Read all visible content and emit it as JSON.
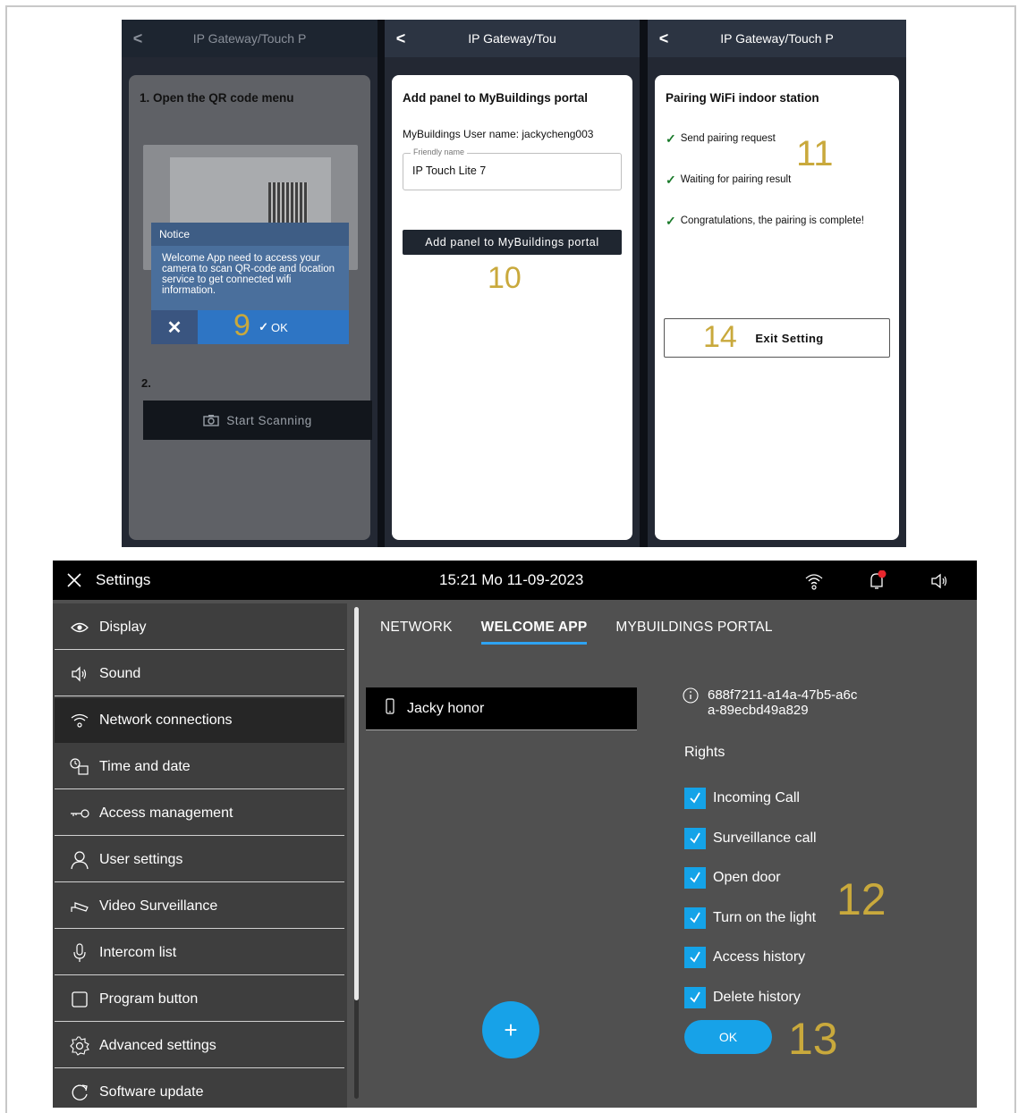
{
  "phones": {
    "p1": {
      "title": "IP Gateway/Touch P",
      "step1": "1. Open the QR code menu",
      "notice_title": "Notice",
      "notice_body": "Welcome App need to access your camera to scan QR-code and location service to get connected wifi information.",
      "ok_label": "OK",
      "step2": "2.",
      "scan_label": "Start Scanning"
    },
    "p2": {
      "title": "IP Gateway/Tou",
      "heading": "Add panel to MyBuildings portal",
      "user_line": "MyBuildings User name: jackycheng003",
      "friendly_label": "Friendly name",
      "friendly_value": "IP Touch Lite 7",
      "button": "Add panel to MyBuildings portal"
    },
    "p3": {
      "title": "IP Gateway/Touch P",
      "heading": "Pairing WiFi indoor station",
      "steps": [
        "Send pairing request",
        "Waiting for pairing result",
        "Congratulations, the pairing is complete!"
      ],
      "exit_label": "Exit Setting"
    }
  },
  "annotations": {
    "a9": "9",
    "a10": "10",
    "a11": "11",
    "a12": "12",
    "a13": "13",
    "a14": "14"
  },
  "settings": {
    "title": "Settings",
    "datetime": "15:21  Mo 11-09-2023",
    "sidebar": [
      {
        "label": "Display",
        "icon": "eye-icon"
      },
      {
        "label": "Sound",
        "icon": "speaker-icon"
      },
      {
        "label": "Network connections",
        "icon": "wifi-icon"
      },
      {
        "label": "Time and date",
        "icon": "clock-calendar-icon"
      },
      {
        "label": "Access  management",
        "icon": "key-icon"
      },
      {
        "label": "User settings",
        "icon": "user-icon"
      },
      {
        "label": "Video Surveillance",
        "icon": "camera-icon"
      },
      {
        "label": "Intercom list",
        "icon": "microphone-icon"
      },
      {
        "label": "Program button",
        "icon": "square-icon"
      },
      {
        "label": "Advanced settings",
        "icon": "gear-icon"
      },
      {
        "label": "Software update",
        "icon": "refresh-icon"
      }
    ],
    "tabs": [
      "NETWORK",
      "WELCOME APP",
      "MYBUILDINGS PORTAL"
    ],
    "device_name": "Jacky honor",
    "device_id": "688f7211-a14a-47b5-a6ca-89ecbd49a829",
    "rights_heading": "Rights",
    "rights": [
      "Incoming Call",
      "Surveillance call",
      "Open door",
      "Turn on the light",
      "Access history",
      "Delete history"
    ],
    "ok_label": "OK",
    "add_label": "+"
  },
  "colors": {
    "accent": "#17a2e8",
    "annotation": "#c9a93c",
    "panel_bg": "#505050",
    "sidebar_bg": "#3e3e3e"
  }
}
